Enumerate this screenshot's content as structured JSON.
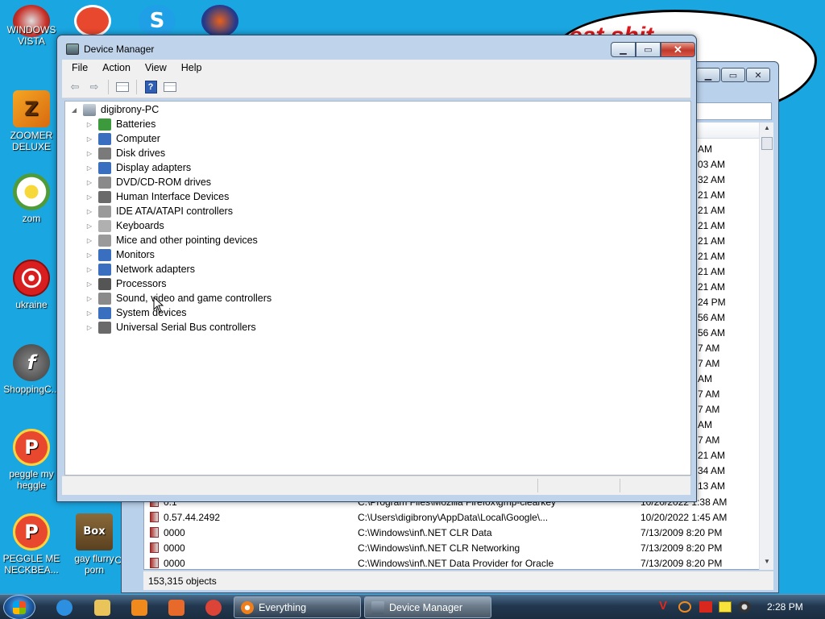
{
  "desktop": {
    "icons": [
      {
        "label": "WINDOWS VISTA",
        "icon": "vista-logo-icon",
        "color": "#c8322a"
      },
      {
        "label": "ZOOMER DELUXE",
        "icon": "zoomer-icon",
        "color": "#e87c1a"
      },
      {
        "label": "zom",
        "icon": "flower-icon",
        "color": "#f2e3a0"
      },
      {
        "label": "ukraine",
        "icon": "radiation-icon",
        "color": "#d81e1e"
      },
      {
        "label": "ShoppingC...",
        "icon": "flash-icon",
        "color": "#555555"
      },
      {
        "label": "peggle my heggle",
        "icon": "peggle-icon",
        "color": "#e8482e"
      },
      {
        "label": "PEGGLE ME NECKBEA...",
        "icon": "peggle-icon",
        "color": "#e8482e"
      },
      {
        "label": "gay flurry porn",
        "icon": "beaver-box-icon",
        "color": "#6c5430"
      }
    ],
    "partial_icon_label": "Co",
    "box_text": "Box",
    "paint_text": "eat shit"
  },
  "background_window": {
    "times": [
      "AM",
      "03 AM",
      "32 AM",
      "21 AM",
      "21 AM",
      "21 AM",
      "21 AM",
      "21 AM",
      "21 AM",
      "21 AM",
      "24 PM",
      "56 AM",
      "56 AM",
      "7 AM",
      "7 AM",
      "AM",
      "7 AM",
      "7 AM",
      "AM",
      "7 AM",
      "21 AM",
      "34 AM",
      "13 AM"
    ],
    "rows": [
      {
        "name": "0.1",
        "path": "C:\\Program Files\\Mozilla Firefox\\gmp-clearkey",
        "date": "10/20/2022 1:38 AM"
      },
      {
        "name": "0.57.44.2492",
        "path": "C:\\Users\\digibrony\\AppData\\Local\\Google\\...",
        "date": "10/20/2022 1:45 AM"
      },
      {
        "name": "0000",
        "path": "C:\\Windows\\inf\\.NET CLR Data",
        "date": "7/13/2009 8:20 PM"
      },
      {
        "name": "0000",
        "path": "C:\\Windows\\inf\\.NET CLR Networking",
        "date": "7/13/2009 8:20 PM"
      },
      {
        "name": "0000",
        "path": "C:\\Windows\\inf\\.NET Data Provider for Oracle",
        "date": "7/13/2009 8:20 PM"
      }
    ],
    "status": "153,315 objects"
  },
  "device_manager": {
    "title": "Device Manager",
    "menu": [
      "File",
      "Action",
      "View",
      "Help"
    ],
    "toolbar": [
      "back-arrow-icon",
      "forward-arrow-icon",
      "show-hide-tree-icon",
      "help-icon",
      "properties-icon"
    ],
    "root": "digibrony-PC",
    "categories": [
      {
        "label": "Batteries",
        "icon": "battery-icon",
        "color": "#3c9a3c"
      },
      {
        "label": "Computer",
        "icon": "computer-icon",
        "color": "#3a6fbf"
      },
      {
        "label": "Disk drives",
        "icon": "disk-drive-icon",
        "color": "#7a7a7a"
      },
      {
        "label": "Display adapters",
        "icon": "display-adapter-icon",
        "color": "#3a6fbf"
      },
      {
        "label": "DVD/CD-ROM drives",
        "icon": "dvd-drive-icon",
        "color": "#8a8a8a"
      },
      {
        "label": "Human Interface Devices",
        "icon": "hid-icon",
        "color": "#6a6a6a"
      },
      {
        "label": "IDE ATA/ATAPI controllers",
        "icon": "ide-controller-icon",
        "color": "#9a9a9a"
      },
      {
        "label": "Keyboards",
        "icon": "keyboard-icon",
        "color": "#b0b0b0"
      },
      {
        "label": "Mice and other pointing devices",
        "icon": "mouse-icon",
        "color": "#9a9a9a"
      },
      {
        "label": "Monitors",
        "icon": "monitor-icon",
        "color": "#3a6fbf"
      },
      {
        "label": "Network adapters",
        "icon": "network-adapter-icon",
        "color": "#3a6fbf"
      },
      {
        "label": "Processors",
        "icon": "processor-icon",
        "color": "#555555"
      },
      {
        "label": "Sound, video and game controllers",
        "icon": "speaker-icon",
        "color": "#8a8a8a"
      },
      {
        "label": "System devices",
        "icon": "system-devices-icon",
        "color": "#3a6fbf"
      },
      {
        "label": "Universal Serial Bus controllers",
        "icon": "usb-icon",
        "color": "#6a6a6a"
      }
    ]
  },
  "taskbar": {
    "quicklaunch": [
      {
        "icon": "internet-explorer-icon",
        "color": "#2d8fe0"
      },
      {
        "icon": "explorer-folder-icon",
        "color": "#e9c45a"
      },
      {
        "icon": "media-player-icon",
        "color": "#f08a1c"
      },
      {
        "icon": "paint-icon",
        "color": "#e86a2a"
      },
      {
        "icon": "chrome-icon",
        "color": "#db4437"
      }
    ],
    "buttons": [
      {
        "label": "Everything",
        "icon": "everything-search-icon"
      },
      {
        "label": "Device Manager",
        "icon": "device-manager-icon"
      }
    ],
    "tray": [
      "v-icon",
      "search-tray-icon",
      "flag-icon",
      "notes-icon",
      "speaker-tray-icon"
    ],
    "clock": "2:28 PM"
  }
}
